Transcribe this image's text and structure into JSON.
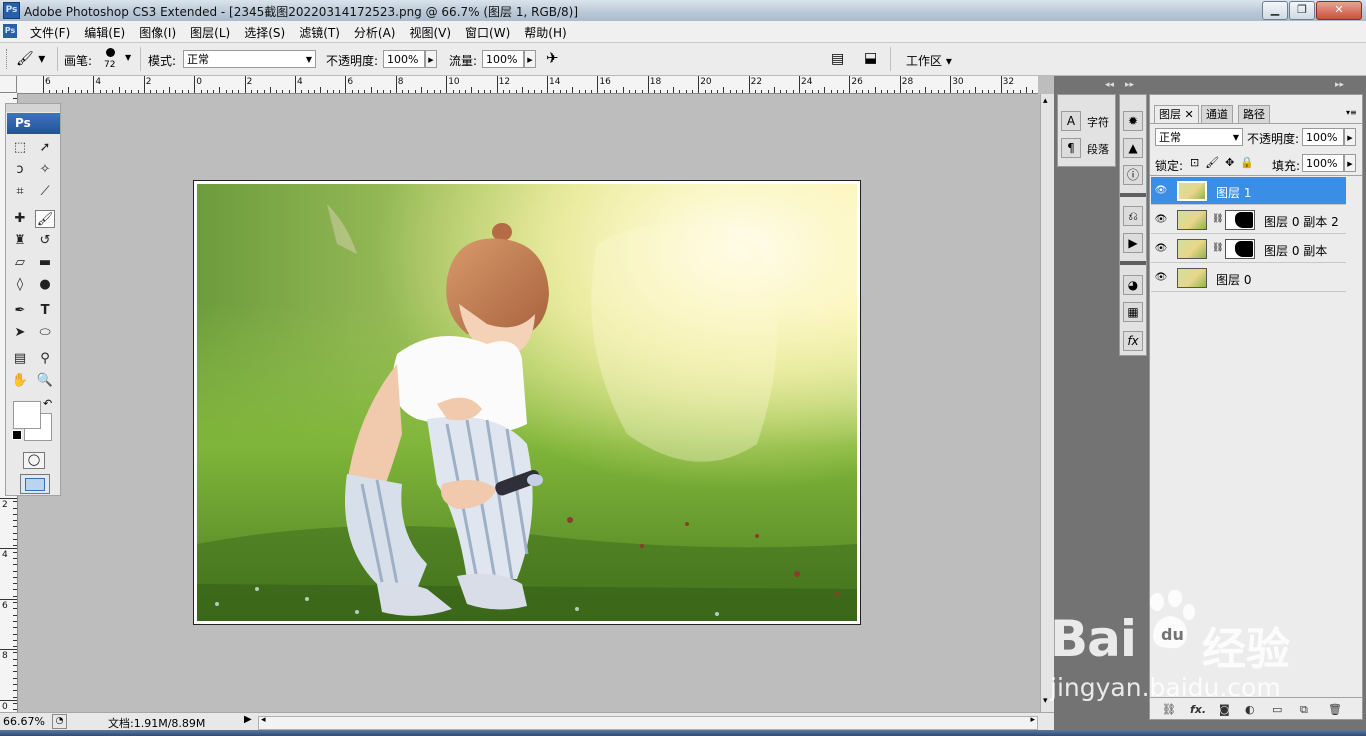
{
  "titlebar": {
    "logo": "Ps",
    "title": "Adobe Photoshop CS3 Extended - [2345截图20220314172523.png @ 66.7% (图层 1, RGB/8)]"
  },
  "menubar": {
    "logo": "Ps",
    "items": [
      "文件(F)",
      "编辑(E)",
      "图像(I)",
      "图层(L)",
      "选择(S)",
      "滤镜(T)",
      "分析(A)",
      "视图(V)",
      "窗口(W)",
      "帮助(H)"
    ]
  },
  "options": {
    "brush_label": "画笔:",
    "brush_size": "72",
    "mode_label": "模式:",
    "mode_value": "正常",
    "opacity_label": "不透明度:",
    "opacity_value": "100%",
    "flow_label": "流量:",
    "flow_value": "100%",
    "workspace_label": "工作区 ▾"
  },
  "rulers": {
    "h_labels": [
      "6",
      "4",
      "2",
      "0",
      "2",
      "4",
      "6",
      "8",
      "10",
      "12",
      "14",
      "16",
      "18",
      "20",
      "22",
      "24",
      "26",
      "28",
      "30",
      "32"
    ],
    "v_labels": [
      "2",
      "4",
      "6",
      "8",
      "0"
    ]
  },
  "statusbar": {
    "zoom": "66.67%",
    "doc_info": "文档:1.91M/8.89M"
  },
  "dock1": {
    "items": [
      {
        "icon": "A",
        "label": "字符"
      },
      {
        "icon": "¶",
        "label": "段落"
      }
    ]
  },
  "layers_panel": {
    "tabs": [
      "图层",
      "通道",
      "路径"
    ],
    "blend_mode": "正常",
    "opacity_label": "不透明度:",
    "opacity_value": "100%",
    "lock_label": "锁定:",
    "fill_label": "填充:",
    "fill_value": "100%",
    "layers": [
      {
        "name": "图层 1",
        "selected": true,
        "mask": false
      },
      {
        "name": "图层 0 副本 2",
        "selected": false,
        "mask": true
      },
      {
        "name": "图层 0 副本",
        "selected": false,
        "mask": true
      },
      {
        "name": "图层 0",
        "selected": false,
        "mask": false
      }
    ],
    "bottom_buttons": [
      "link-icon",
      "fx-icon",
      "mask-icon",
      "adjustment-icon",
      "group-icon",
      "new-layer-icon",
      "trash-icon"
    ]
  },
  "watermark": {
    "brand": "Bai",
    "brand2": "经验",
    "url": "jingyan.baidu.com"
  },
  "colors": {
    "selection": "#3a8ee6",
    "ps_blue": "#2a5fa8"
  }
}
